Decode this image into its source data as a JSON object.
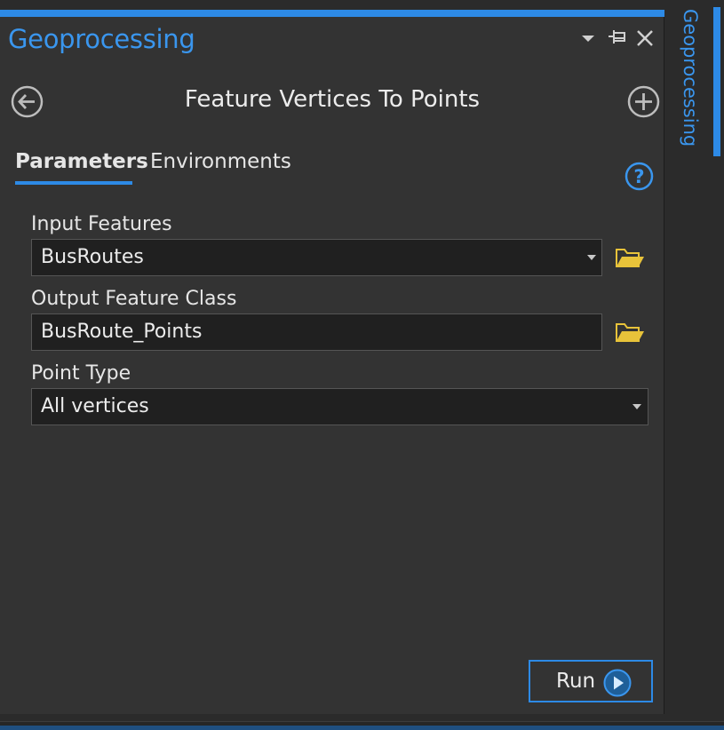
{
  "pane": {
    "title": "Geoprocessing",
    "controls": {
      "menu_icon": "chevron-down-icon",
      "pin_icon": "pin-icon",
      "close_icon": "close-icon"
    }
  },
  "tool": {
    "title": "Feature Vertices To Points",
    "back_icon": "back-arrow-icon",
    "add_icon": "plus-circle-icon"
  },
  "tabs": [
    {
      "label": "Parameters",
      "active": true
    },
    {
      "label": "Environments",
      "active": false
    }
  ],
  "help_icon": "help-icon",
  "parameters": {
    "input_features": {
      "label": "Input Features",
      "value": "BusRoutes"
    },
    "output_feature_class": {
      "label": "Output Feature Class",
      "value": "BusRoute_Points"
    },
    "point_type": {
      "label": "Point Type",
      "value": "All vertices"
    }
  },
  "run": {
    "label": "Run",
    "icon": "play-circle-icon"
  },
  "dock_tab": {
    "label": "Geoprocessing"
  },
  "colors": {
    "accent": "#2d8ae6",
    "title_blue": "#3a96ee",
    "folder_yellow": "#e8c33a",
    "panel_bg": "#333333",
    "input_bg": "#202020"
  }
}
